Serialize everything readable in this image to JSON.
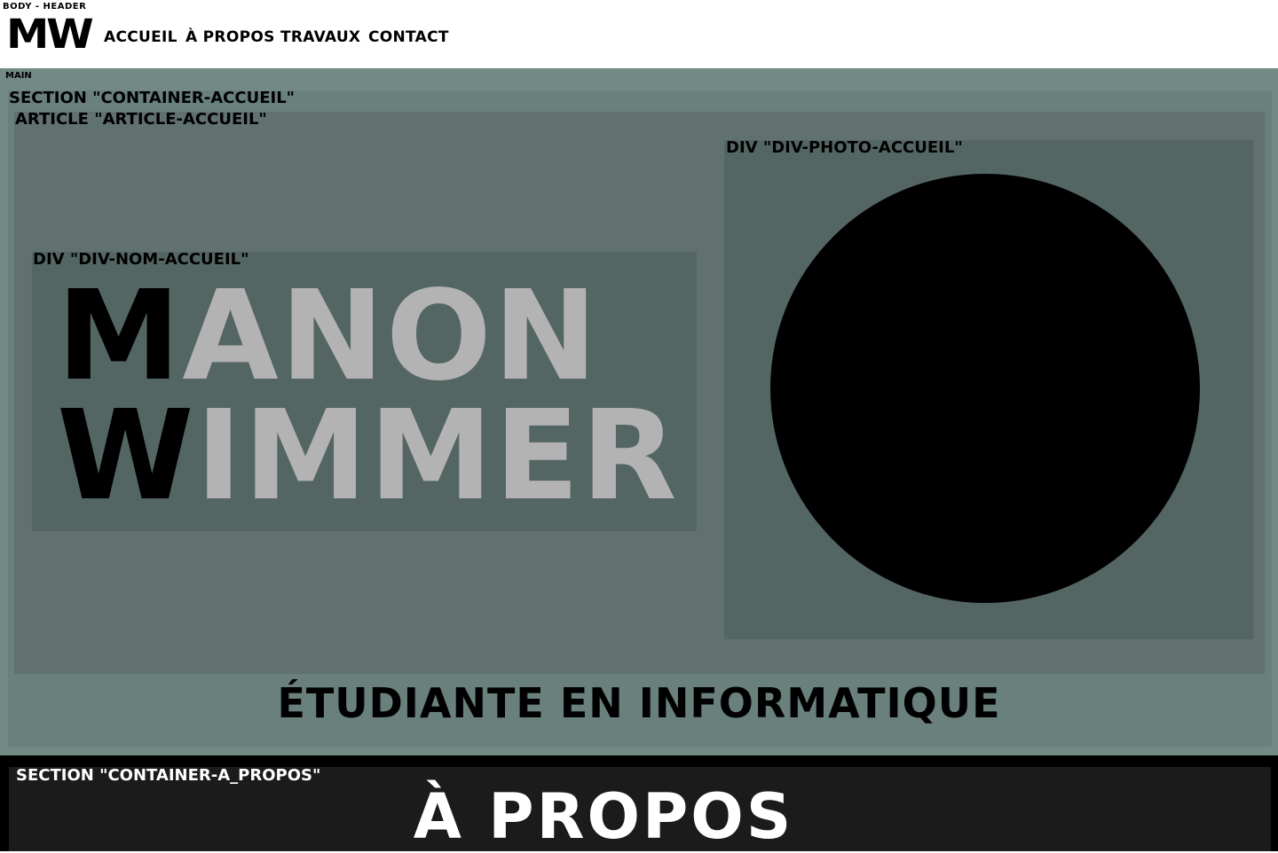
{
  "header": {
    "debug_label": "BODY - HEADER",
    "logo": "MW",
    "nav": [
      "ACCUEIL",
      "À PROPOS",
      "TRAVAUX",
      "CONTACT"
    ]
  },
  "main": {
    "debug_label": "MAIN",
    "section_accueil": {
      "debug_label": "SECTION \"CONTAINER-ACCUEIL\"",
      "article": {
        "debug_label": "ARTICLE \"ARTICLE-ACCUEIL\"",
        "div_nom": {
          "debug_label": "DIV \"DIV-NOM-ACCUEIL\"",
          "first_name_initial": "M",
          "first_name_rest": "ANON",
          "last_name_initial": "W",
          "last_name_rest": "IMMER"
        },
        "div_photo": {
          "debug_label": "DIV \"DIV-PHOTO-ACCUEIL\""
        }
      },
      "subtitle": "ÉTUDIANTE EN INFORMATIQUE"
    },
    "section_apropos": {
      "debug_label": "SECTION \"CONTAINER-A_PROPOS\"",
      "title": "À PROPOS"
    }
  },
  "colors": {
    "main_bg": "#728985",
    "section_bg": "#69807c",
    "article_bg": "#60716f",
    "div_bg": "#546663",
    "name_rest": "#b3b3b3",
    "apropos_bg": "#1b1b1b"
  }
}
